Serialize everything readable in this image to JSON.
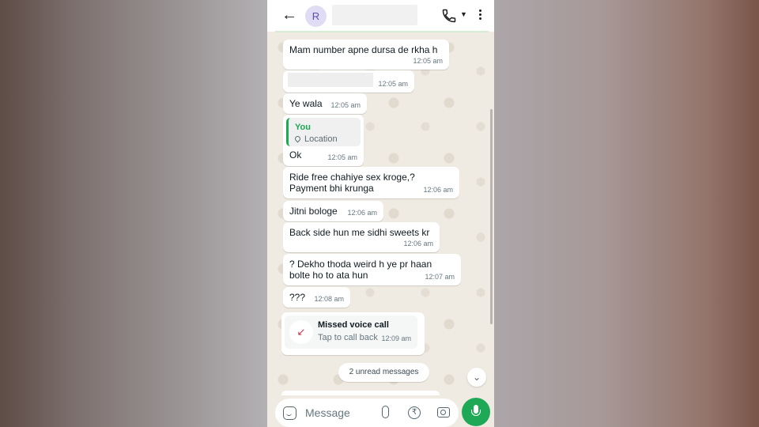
{
  "header": {
    "back_icon": "arrow-left-icon",
    "avatar_letter": "R",
    "call_icon": "phone-icon",
    "menu_icon": "more-vert-icon"
  },
  "messages": [
    {
      "text": "Mam number apne dursa de rkha h",
      "time": "12:05 am"
    },
    {
      "text": "",
      "time": "12:05 am",
      "redacted": true
    },
    {
      "text": "Ye wala",
      "time": "12:05 am"
    },
    {
      "reply_to": {
        "author": "You",
        "label": "Location"
      },
      "text": "Ok",
      "time": "12:05 am"
    },
    {
      "text_line1": "Ride free chahiye sex kroge,?",
      "text_line2": "Payment bhi krunga",
      "time": "12:06 am"
    },
    {
      "text": "Jitni bologe",
      "time": "12:06 am"
    },
    {
      "text": "Back side hun me sidhi sweets kr",
      "time": "12:06 am"
    },
    {
      "text_line1": "? Dekho thoda weird h ye pr haan",
      "text_line2": "bolte ho to ata hun",
      "time": "12:07 am"
    },
    {
      "text": "???",
      "time": "12:08 am"
    }
  ],
  "missed_call": {
    "title": "Missed voice call",
    "subtitle": "Tap to call back",
    "time": "12:09 am",
    "icon": "missed-call-icon"
  },
  "unread_label": "2 unread messages",
  "composer": {
    "placeholder": "Message",
    "icons": [
      "sticker-icon",
      "attach-icon",
      "rupee-icon",
      "camera-icon",
      "mic-icon"
    ]
  },
  "colors": {
    "accent": "#1fa855",
    "chat_bg": "#efeae2",
    "bubble": "#ffffff",
    "missed": "#c03446"
  }
}
